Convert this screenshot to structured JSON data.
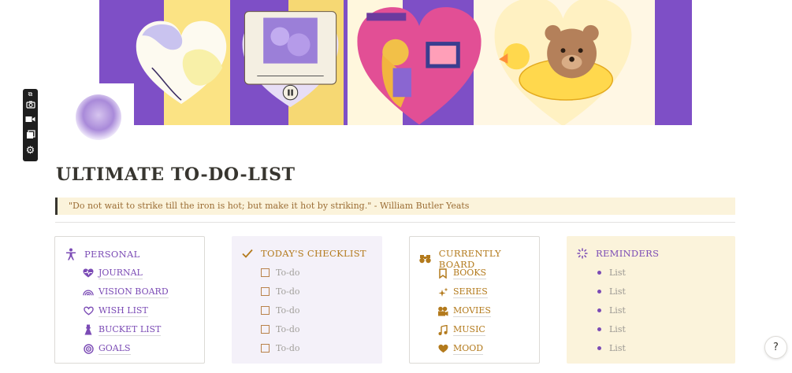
{
  "page": {
    "title": "ULTIMATE TO-DO-LIST",
    "quote": "\"Do not wait to strike till the iron is hot; but make it hot by striking.\" - William Butler Yeats"
  },
  "toolbar": {
    "icons": [
      "copy-icon",
      "camera-icon",
      "video-icon",
      "window-icon",
      "gear-icon"
    ]
  },
  "colors": {
    "accent_purple": "#7b4bb5",
    "accent_gold": "#b37a1c",
    "quote_bg": "#fbf3db",
    "checklist_bg": "#f4f1f9",
    "reminders_bg": "#fbf3db",
    "cover_purple": "#7e4fc6",
    "cover_yellow": "#fbe384"
  },
  "personal": {
    "heading": "PERSONAL",
    "items": [
      {
        "label": "JOURNAL",
        "icon": "heart-pulse-icon"
      },
      {
        "label": "VISION BOARD",
        "icon": "rainbow-icon"
      },
      {
        "label": "WISH LIST",
        "icon": "heart-outline-icon"
      },
      {
        "label": "BUCKET LIST",
        "icon": "dress-icon"
      },
      {
        "label": "GOALS",
        "icon": "target-icon"
      }
    ]
  },
  "checklist": {
    "heading": "TODAY'S CHECKLIST",
    "items": [
      "To-do",
      "To-do",
      "To-do",
      "To-do",
      "To-do"
    ]
  },
  "board": {
    "heading": "CURRENTLY BOARD",
    "items": [
      {
        "label": "BOOKS",
        "icon": "bookmark-icon"
      },
      {
        "label": "SERIES",
        "icon": "sparkles-icon"
      },
      {
        "label": "MOVIES",
        "icon": "film-camera-icon"
      },
      {
        "label": "MUSIC",
        "icon": "music-note-icon"
      },
      {
        "label": "MOOD",
        "icon": "heart-icon"
      }
    ]
  },
  "reminders": {
    "heading": "REMINDERS",
    "items": [
      "List",
      "List",
      "List",
      "List",
      "List"
    ]
  },
  "help": {
    "label": "?"
  }
}
